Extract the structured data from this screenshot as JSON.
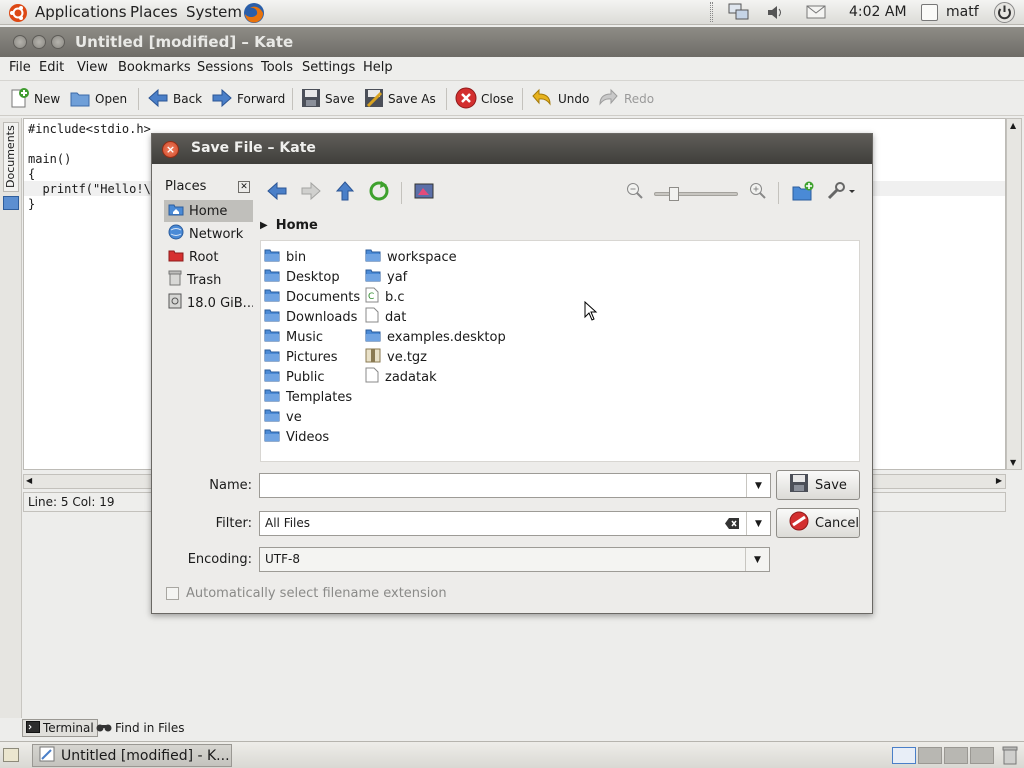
{
  "top_panel": {
    "menus": [
      "Applications",
      "Places",
      "System"
    ],
    "clock": "4:02 AM",
    "user": "matf"
  },
  "kate": {
    "title": "Untitled [modified] – Kate",
    "menubar": [
      "File",
      "Edit",
      "View",
      "Bookmarks",
      "Sessions",
      "Tools",
      "Settings",
      "Help"
    ],
    "toolbar": {
      "new": "New",
      "open": "Open",
      "back": "Back",
      "forward": "Forward",
      "save": "Save",
      "save_as": "Save As",
      "close": "Close",
      "undo": "Undo",
      "redo": "Redo"
    },
    "side_tab": "Documents",
    "code": [
      "#include<stdio.h>",
      "",
      "main()",
      "{",
      "  printf(\"Hello!\\n",
      "}"
    ],
    "status": "Line: 5 Col: 19",
    "tool_tabs": {
      "terminal": "Terminal",
      "find": "Find in Files"
    }
  },
  "taskbar": {
    "task": "Untitled [modified] - K..."
  },
  "dialog": {
    "title": "Save File – Kate",
    "places": {
      "header": "Places",
      "items": [
        "Home",
        "Network",
        "Root",
        "Trash",
        "18.0 GiB..."
      ]
    },
    "breadcrumb": "Home",
    "files_col1": [
      "bin",
      "Desktop",
      "Documents",
      "Downloads",
      "Music",
      "Pictures",
      "Public",
      "Templates",
      "ve",
      "Videos"
    ],
    "files_col2": [
      "workspace",
      "yaf",
      "b.c",
      "dat",
      "examples.desktop",
      "ve.tgz",
      "zadatak"
    ],
    "name_label": "Name:",
    "name_value": "",
    "filter_label": "Filter:",
    "filter_value": "All Files",
    "encoding_label": "Encoding:",
    "encoding_value": "UTF-8",
    "save_button": "Save",
    "cancel_button": "Cancel",
    "auto_ext": "Automatically select filename extension"
  },
  "colors": {
    "folder": "#4a8ad6",
    "dialog_title": "#4a4946",
    "window_title": "#7c7a75"
  }
}
